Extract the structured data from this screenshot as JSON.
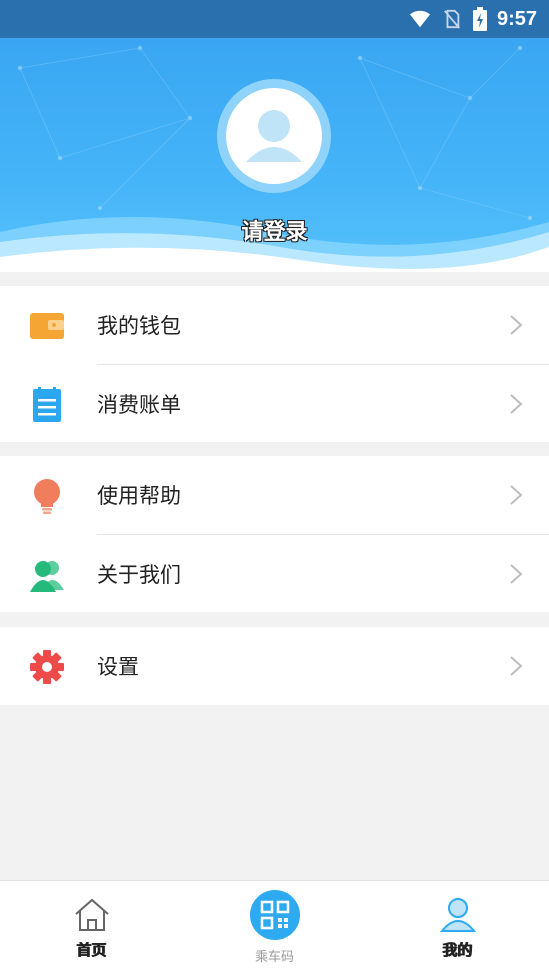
{
  "status_bar": {
    "time": "9:57",
    "icons": [
      "wifi-icon",
      "no-sim-icon",
      "battery-charging-icon"
    ]
  },
  "profile": {
    "avatar_icon": "user-avatar-icon",
    "login_label": "请登录"
  },
  "menu": {
    "group1": [
      {
        "label": "我的钱包",
        "icon": "wallet-icon",
        "color": "#f5a534"
      },
      {
        "label": "消费账单",
        "icon": "bill-icon",
        "color": "#2aa7ef"
      }
    ],
    "group2": [
      {
        "label": "使用帮助",
        "icon": "lightbulb-icon",
        "color": "#f07d5c"
      },
      {
        "label": "关于我们",
        "icon": "users-icon",
        "color": "#25b97c"
      }
    ],
    "group3": [
      {
        "label": "设置",
        "icon": "gear-icon",
        "color": "#ef4a4a"
      }
    ]
  },
  "tab_bar": {
    "tabs": [
      {
        "label": "首页",
        "icon": "home-icon"
      },
      {
        "label": "乘车码",
        "icon": "qr-code-icon"
      },
      {
        "label": "我的",
        "icon": "profile-icon"
      }
    ]
  },
  "colors": {
    "header_blue": "#3aa6f3",
    "status_bar": "#2a6fae",
    "qr_blue": "#2eaaf0"
  }
}
